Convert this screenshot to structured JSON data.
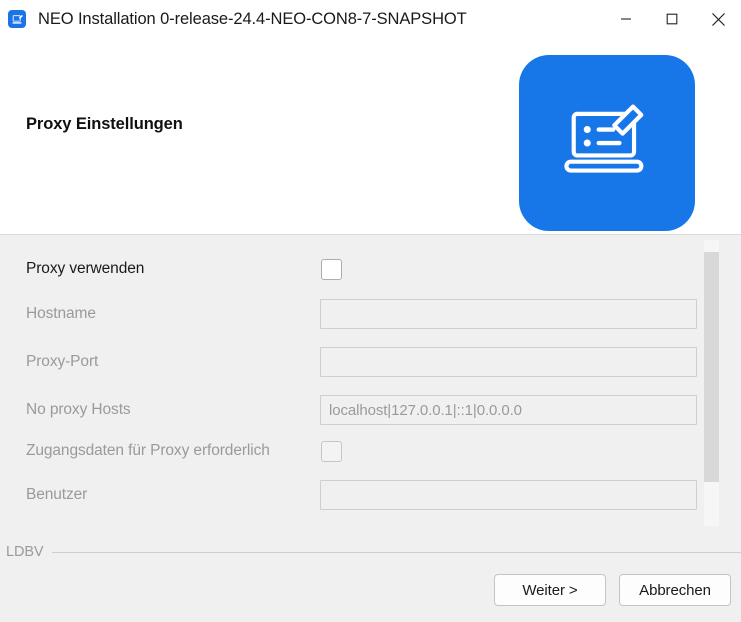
{
  "window": {
    "title": "NEO Installation 0-release-24.4-NEO-CON8-7-SNAPSHOT",
    "app_icon": "laptop-pencil-icon",
    "controls": {
      "minimize": "minimize-icon",
      "maximize": "maximize-icon",
      "close": "close-icon"
    }
  },
  "header": {
    "title": "Proxy Einstellungen",
    "logo_icon": "laptop-pencil-logo",
    "logo_color": "#1877e8"
  },
  "form": {
    "rows": [
      {
        "label": "Proxy verwenden",
        "type": "checkbox",
        "checked": false,
        "enabled": true,
        "value": "",
        "name": "proxy-verwenden"
      },
      {
        "label": "Hostname",
        "type": "text",
        "checked": false,
        "enabled": false,
        "value": "",
        "name": "hostname"
      },
      {
        "label": "Proxy-Port",
        "type": "text",
        "checked": false,
        "enabled": false,
        "value": "",
        "name": "proxy-port"
      },
      {
        "label": "No proxy Hosts",
        "type": "text",
        "checked": false,
        "enabled": false,
        "value": "localhost|127.0.0.1|::1|0.0.0.0",
        "name": "no-proxy-hosts"
      },
      {
        "label": "Zugangsdaten für Proxy erforderlich",
        "type": "checkbox",
        "checked": false,
        "enabled": false,
        "value": "",
        "name": "zugangsdaten-erforderlich"
      },
      {
        "label": "Benutzer",
        "type": "text",
        "checked": false,
        "enabled": false,
        "value": "",
        "name": "benutzer"
      }
    ]
  },
  "footer": {
    "brand": "LDBV",
    "next_label": "Weiter >",
    "cancel_label": "Abbrechen"
  }
}
